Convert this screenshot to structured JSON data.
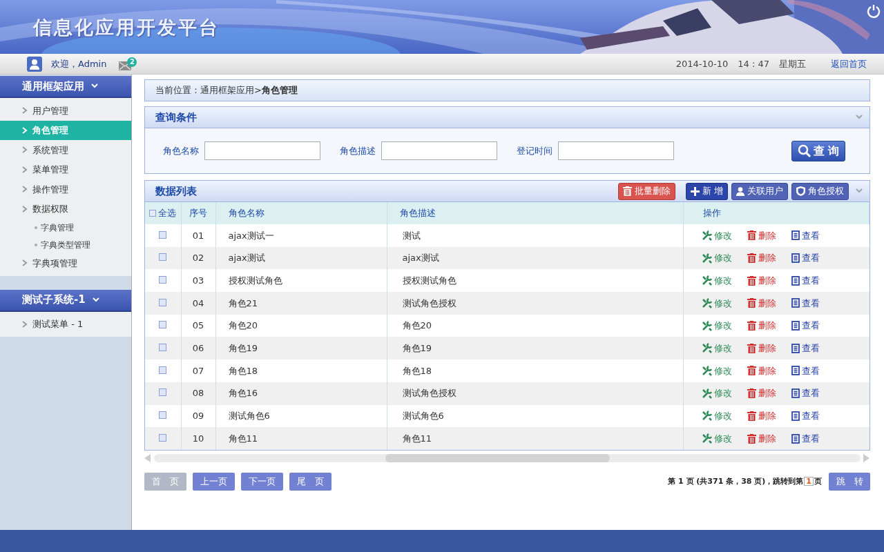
{
  "header": {
    "title": "信息化应用开发平台",
    "greeting": "欢迎，Admin",
    "unread": "2",
    "date": "2014-10-10",
    "time": "14 : 47",
    "weekday": "星期五",
    "home_link": "返回首页"
  },
  "sidebar": {
    "groups": [
      {
        "title": "通用框架应用",
        "expanded": true,
        "items": [
          {
            "label": "用户管理",
            "selected": false
          },
          {
            "label": "角色管理",
            "selected": true
          },
          {
            "label": "系统管理",
            "selected": false
          },
          {
            "label": "菜单管理",
            "selected": false
          },
          {
            "label": "操作管理",
            "selected": false
          },
          {
            "label": "数据权限",
            "selected": false,
            "children": [
              {
                "label": "字典管理",
                "selected": false
              },
              {
                "label": "字典类型管理",
                "selected": false
              }
            ]
          },
          {
            "label": "字典项管理",
            "selected": false
          }
        ]
      },
      {
        "title": "测试子系统-1",
        "expanded": true,
        "items": [
          {
            "label": "测试菜单 - 1",
            "selected": false
          }
        ]
      }
    ]
  },
  "breadcrumb": "当前位置：通用框架应用>**角色管理**",
  "query": {
    "title": "查询条件",
    "fields": [
      {
        "label": "角色名称"
      },
      {
        "label": "角色描述"
      },
      {
        "label": "登记时间"
      }
    ],
    "button": "查 询"
  },
  "list": {
    "title": "数据列表",
    "actions": [
      {
        "label": "批量删除",
        "kind": "delete"
      },
      {
        "label": "新 增",
        "kind": "add"
      },
      {
        "label": "关联用户",
        "kind": "user"
      },
      {
        "label": "角色授权",
        "kind": "auth"
      }
    ],
    "select_all": {
      "label": "全选",
      "checked": false
    },
    "columns": [
      "序号",
      "角色名称",
      "角色描述",
      "操作"
    ],
    "rows": [
      {
        "no": "01",
        "name": "ajax测试一",
        "desc": "测试",
        "checked": false,
        "actions": [
          {
            "label": "修改",
            "kind": "edit"
          },
          {
            "label": "删除",
            "kind": "delete"
          },
          {
            "label": "查看",
            "kind": "view"
          }
        ]
      },
      {
        "no": "02",
        "name": "ajax测试",
        "desc": "ajax测试",
        "checked": false,
        "actions": [
          {
            "label": "修改",
            "kind": "edit"
          },
          {
            "label": "删除",
            "kind": "delete"
          },
          {
            "label": "查看",
            "kind": "view"
          }
        ]
      },
      {
        "no": "03",
        "name": "授权测试角色",
        "desc": "授权测试角色",
        "checked": false,
        "actions": [
          {
            "label": "修改",
            "kind": "edit"
          },
          {
            "label": "删除",
            "kind": "delete"
          },
          {
            "label": "查看",
            "kind": "view"
          }
        ]
      },
      {
        "no": "04",
        "name": "角色21",
        "desc": "测试角色授权",
        "checked": false,
        "actions": [
          {
            "label": "修改",
            "kind": "edit"
          },
          {
            "label": "删除",
            "kind": "delete"
          },
          {
            "label": "查看",
            "kind": "view"
          }
        ]
      },
      {
        "no": "05",
        "name": "角色20",
        "desc": "角色20",
        "checked": false,
        "actions": [
          {
            "label": "修改",
            "kind": "edit"
          },
          {
            "label": "删除",
            "kind": "delete"
          },
          {
            "label": "查看",
            "kind": "view"
          }
        ]
      },
      {
        "no": "06",
        "name": "角色19",
        "desc": "角色19",
        "checked": false,
        "actions": [
          {
            "label": "修改",
            "kind": "edit"
          },
          {
            "label": "删除",
            "kind": "delete"
          },
          {
            "label": "查看",
            "kind": "view"
          }
        ]
      },
      {
        "no": "07",
        "name": "角色18",
        "desc": "角色18",
        "checked": false,
        "actions": [
          {
            "label": "修改",
            "kind": "edit"
          },
          {
            "label": "删除",
            "kind": "delete"
          },
          {
            "label": "查看",
            "kind": "view"
          }
        ]
      },
      {
        "no": "08",
        "name": "角色16",
        "desc": "测试角色授权",
        "checked": false,
        "actions": [
          {
            "label": "修改",
            "kind": "edit"
          },
          {
            "label": "删除",
            "kind": "delete"
          },
          {
            "label": "查看",
            "kind": "view"
          }
        ]
      },
      {
        "no": "09",
        "name": "测试角色6",
        "desc": "测试角色6",
        "checked": false,
        "actions": [
          {
            "label": "修改",
            "kind": "edit"
          },
          {
            "label": "删除",
            "kind": "delete"
          },
          {
            "label": "查看",
            "kind": "view"
          }
        ]
      },
      {
        "no": "10",
        "name": "角色11",
        "desc": "角色11",
        "checked": false,
        "actions": [
          {
            "label": "修改",
            "kind": "edit"
          },
          {
            "label": "删除",
            "kind": "delete"
          },
          {
            "label": "查看",
            "kind": "view"
          }
        ]
      }
    ]
  },
  "pagination": {
    "buttons": [
      {
        "label": "首　页",
        "disabled": true
      },
      {
        "label": "上一页",
        "disabled": false
      },
      {
        "label": "下一页",
        "disabled": false
      },
      {
        "label": "尾　页",
        "disabled": false
      }
    ],
    "info": "第 1 页 (共371 条，38 页)，跳转到第",
    "page": "1",
    "suffix": "页",
    "jump": "跳　转"
  }
}
